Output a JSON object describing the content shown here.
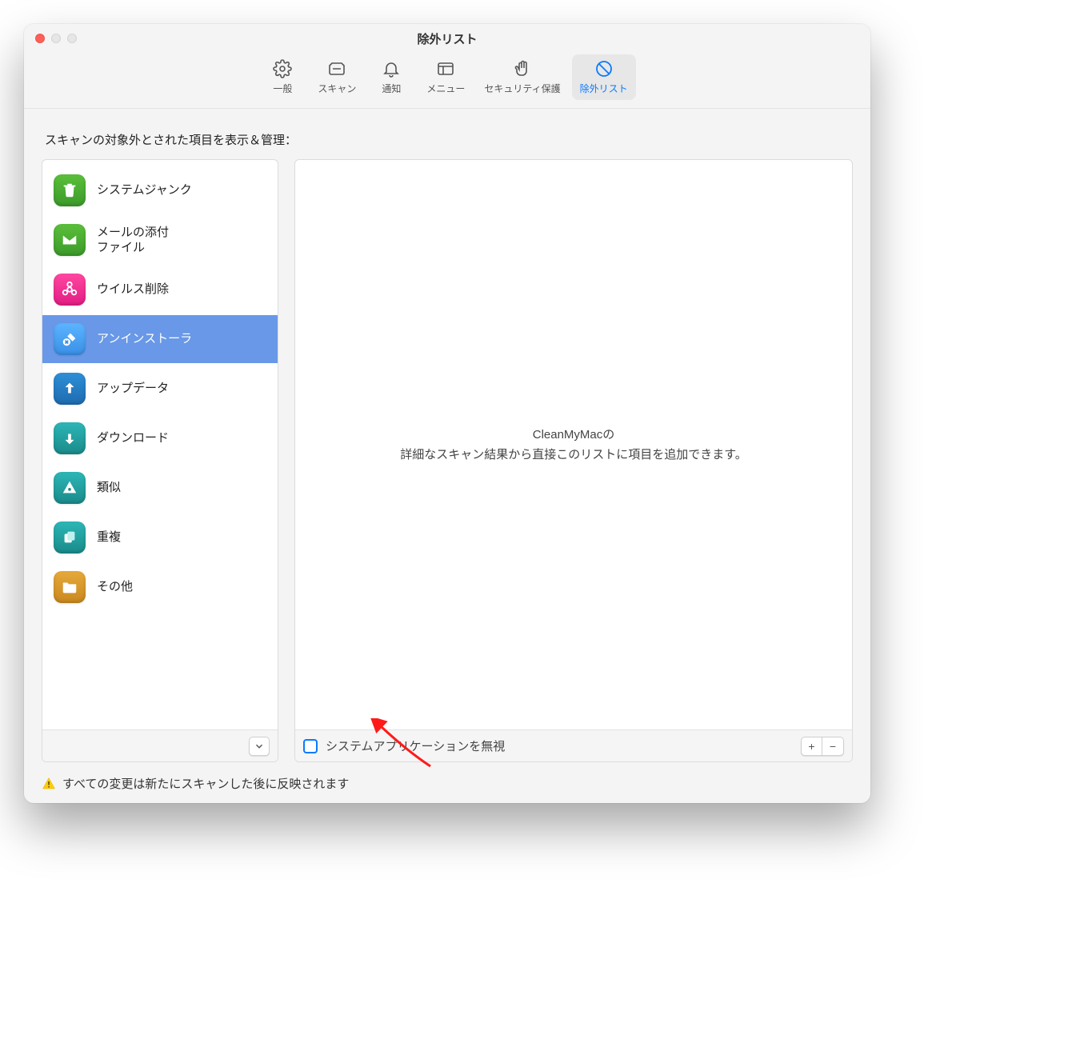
{
  "window_title": "除外リスト",
  "tabs": {
    "general": {
      "label": "一般"
    },
    "scan": {
      "label": "スキャン"
    },
    "notify": {
      "label": "通知"
    },
    "menu": {
      "label": "メニュー"
    },
    "security": {
      "label": "セキュリティ保護"
    },
    "ignore": {
      "label": "除外リスト"
    }
  },
  "section_heading": "スキャンの対象外とされた項目を表示＆管理：",
  "categories": [
    {
      "label": "システムジャンク"
    },
    {
      "label": "メールの添付\nファイル"
    },
    {
      "label": "ウイルス削除"
    },
    {
      "label": "アンインストーラ"
    },
    {
      "label": "アップデータ"
    },
    {
      "label": "ダウンロード"
    },
    {
      "label": "類似"
    },
    {
      "label": "重複"
    },
    {
      "label": "その他"
    }
  ],
  "empty_line1": "CleanMyMacの",
  "empty_line2": "詳細なスキャン結果から直接このリストに項目を追加できます。",
  "ignore_system_apps_label": "システムアプリケーションを無視",
  "plus_label": "+",
  "minus_label": "−",
  "warning_text": "すべての変更は新たにスキャンした後に反映されます"
}
